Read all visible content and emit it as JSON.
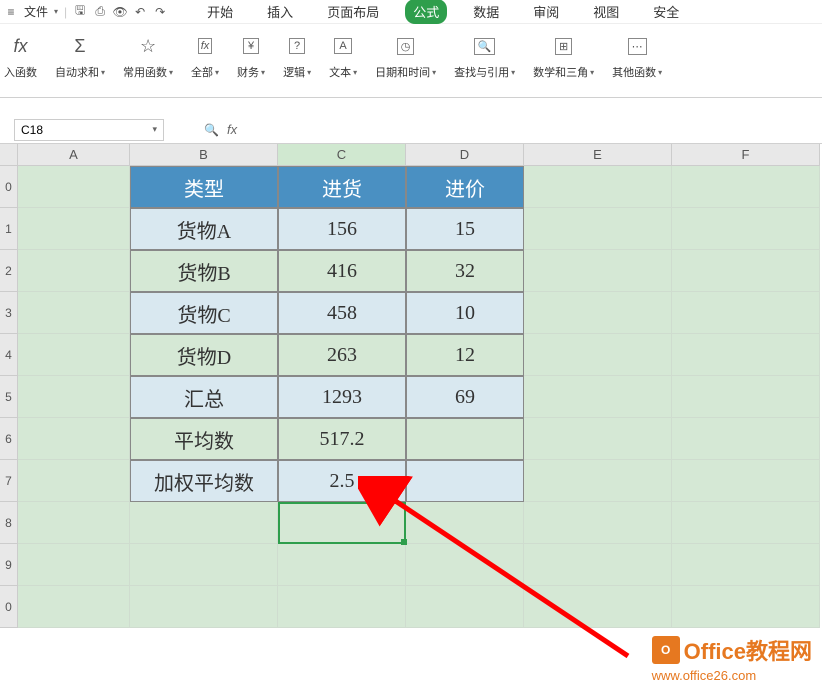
{
  "menu": {
    "file": "文件",
    "tabs": [
      "开始",
      "插入",
      "页面布局",
      "公式",
      "数据",
      "审阅",
      "视图",
      "安全"
    ],
    "active_tab_index": 3
  },
  "ribbon": {
    "items": [
      {
        "label": "入函数",
        "icon": "fx"
      },
      {
        "label": "自动求和",
        "icon": "Σ",
        "drop": true
      },
      {
        "label": "常用函数",
        "icon": "★",
        "drop": true
      },
      {
        "label": "全部",
        "icon": "fx",
        "drop": true
      },
      {
        "label": "财务",
        "icon": "¥",
        "drop": true
      },
      {
        "label": "逻辑",
        "icon": "?",
        "drop": true
      },
      {
        "label": "文本",
        "icon": "A",
        "drop": true
      },
      {
        "label": "日期和时间",
        "icon": "⊙",
        "drop": true
      },
      {
        "label": "查找与引用",
        "icon": "Q",
        "drop": true
      },
      {
        "label": "数学和三角",
        "icon": "⊞",
        "drop": true
      },
      {
        "label": "其他函数",
        "icon": "…",
        "drop": true
      }
    ]
  },
  "formula_bar": {
    "name_box": "C18",
    "formula": ""
  },
  "columns": [
    "A",
    "B",
    "C",
    "D",
    "E",
    "F"
  ],
  "active_column": "C",
  "row_labels": [
    "0",
    "1",
    "2",
    "3",
    "4",
    "5",
    "6",
    "7",
    "8",
    "9",
    "0"
  ],
  "table": {
    "headers": [
      "类型",
      "进货",
      "进价"
    ],
    "rows": [
      [
        "货物A",
        "156",
        "15"
      ],
      [
        "货物B",
        "416",
        "32"
      ],
      [
        "货物C",
        "458",
        "10"
      ],
      [
        "货物D",
        "263",
        "12"
      ],
      [
        "汇总",
        "1293",
        "69"
      ],
      [
        "平均数",
        "517.2",
        ""
      ],
      [
        "加权平均数",
        "2.5",
        ""
      ]
    ]
  },
  "watermark": {
    "badge": "O",
    "text": "Office教程网",
    "url": "www.office26.com"
  },
  "chart_data": {
    "type": "table",
    "title": "",
    "columns": [
      "类型",
      "进货",
      "进价"
    ],
    "data": [
      {
        "类型": "货物A",
        "进货": 156,
        "进价": 15
      },
      {
        "类型": "货物B",
        "进货": 416,
        "进价": 32
      },
      {
        "类型": "货物C",
        "进货": 458,
        "进价": 10
      },
      {
        "类型": "货物D",
        "进货": 263,
        "进价": 12
      },
      {
        "类型": "汇总",
        "进货": 1293,
        "进价": 69
      },
      {
        "类型": "平均数",
        "进货": 517.2,
        "进价": null
      },
      {
        "类型": "加权平均数",
        "进货": 2.5,
        "进价": null
      }
    ]
  }
}
